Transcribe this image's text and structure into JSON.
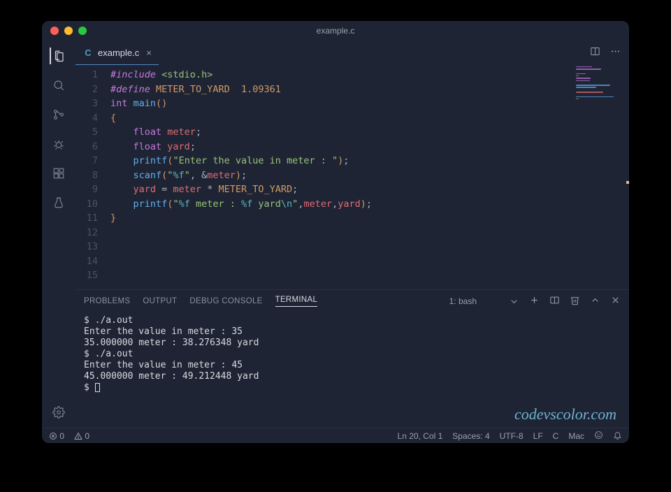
{
  "window": {
    "title": "example.c"
  },
  "tab": {
    "icon_letter": "C",
    "label": "example.c"
  },
  "activity": {
    "items": [
      "explorer",
      "search",
      "source-control",
      "debug",
      "extensions",
      "testing"
    ],
    "bottom": [
      "settings"
    ]
  },
  "editor": {
    "lines": [
      {
        "n": 1,
        "tokens": [
          [
            "c-include",
            "#include"
          ],
          [
            "c-punct",
            " "
          ],
          [
            "c-angle",
            "<stdio.h>"
          ]
        ]
      },
      {
        "n": 2,
        "tokens": [
          [
            "c-include",
            "#define"
          ],
          [
            "c-punct",
            " "
          ],
          [
            "c-const",
            "METER_TO_YARD"
          ],
          [
            "c-punct",
            "  "
          ],
          [
            "c-number",
            "1.09361"
          ]
        ]
      },
      {
        "n": 3,
        "tokens": [
          [
            "c-punct",
            ""
          ]
        ]
      },
      {
        "n": 4,
        "tokens": [
          [
            "c-type",
            "int"
          ],
          [
            "c-punct",
            " "
          ],
          [
            "c-func",
            "main"
          ],
          [
            "c-brace",
            "()"
          ]
        ]
      },
      {
        "n": 5,
        "tokens": [
          [
            "c-brace",
            "{"
          ]
        ]
      },
      {
        "n": 6,
        "tokens": [
          [
            "c-punct",
            "    "
          ],
          [
            "c-type",
            "float"
          ],
          [
            "c-punct",
            " "
          ],
          [
            "c-ident",
            "meter"
          ],
          [
            "c-punct",
            ";"
          ]
        ]
      },
      {
        "n": 7,
        "tokens": [
          [
            "c-punct",
            "    "
          ],
          [
            "c-type",
            "float"
          ],
          [
            "c-punct",
            " "
          ],
          [
            "c-ident",
            "yard"
          ],
          [
            "c-punct",
            ";"
          ]
        ]
      },
      {
        "n": 8,
        "tokens": [
          [
            "c-punct",
            ""
          ]
        ]
      },
      {
        "n": 9,
        "tokens": [
          [
            "c-punct",
            "    "
          ],
          [
            "c-func",
            "printf"
          ],
          [
            "c-brace",
            "("
          ],
          [
            "c-string",
            "\"Enter the value in meter : \""
          ],
          [
            "c-brace",
            ")"
          ],
          [
            "c-punct",
            ";"
          ]
        ]
      },
      {
        "n": 10,
        "tokens": [
          [
            "c-punct",
            "    "
          ],
          [
            "c-func",
            "scanf"
          ],
          [
            "c-brace",
            "("
          ],
          [
            "c-string",
            "\""
          ],
          [
            "c-str-emb",
            "%f"
          ],
          [
            "c-string",
            "\""
          ],
          [
            "c-punct",
            ", &"
          ],
          [
            "c-ident",
            "meter"
          ],
          [
            "c-brace",
            ")"
          ],
          [
            "c-punct",
            ";"
          ]
        ]
      },
      {
        "n": 11,
        "tokens": [
          [
            "c-punct",
            ""
          ]
        ]
      },
      {
        "n": 12,
        "tokens": [
          [
            "c-punct",
            "    "
          ],
          [
            "c-ident",
            "yard"
          ],
          [
            "c-punct",
            " = "
          ],
          [
            "c-ident",
            "meter"
          ],
          [
            "c-punct",
            " * "
          ],
          [
            "c-const",
            "METER_TO_YARD"
          ],
          [
            "c-punct",
            ";"
          ]
        ]
      },
      {
        "n": 13,
        "tokens": [
          [
            "c-punct",
            ""
          ]
        ]
      },
      {
        "n": 14,
        "tokens": [
          [
            "c-punct",
            "    "
          ],
          [
            "c-func",
            "printf"
          ],
          [
            "c-brace",
            "("
          ],
          [
            "c-string",
            "\""
          ],
          [
            "c-str-emb",
            "%f"
          ],
          [
            "c-string",
            " meter : "
          ],
          [
            "c-str-emb",
            "%f"
          ],
          [
            "c-string",
            " yard"
          ],
          [
            "c-str-emb",
            "\\n"
          ],
          [
            "c-string",
            "\""
          ],
          [
            "c-punct",
            ","
          ],
          [
            "c-ident",
            "meter"
          ],
          [
            "c-punct",
            ","
          ],
          [
            "c-ident",
            "yard"
          ],
          [
            "c-brace",
            ")"
          ],
          [
            "c-punct",
            ";"
          ]
        ]
      },
      {
        "n": 15,
        "tokens": [
          [
            "c-brace",
            "}"
          ]
        ]
      }
    ]
  },
  "panel": {
    "tabs": [
      "PROBLEMS",
      "OUTPUT",
      "DEBUG CONSOLE",
      "TERMINAL"
    ],
    "active_tab": "TERMINAL",
    "terminal_selector": "1: bash",
    "terminal_lines": [
      "$ ./a.out",
      "Enter the value in meter : 35",
      "35.000000 meter : 38.276348 yard",
      "$ ./a.out",
      "Enter the value in meter : 45",
      "45.000000 meter : 49.212448 yard"
    ],
    "prompt": "$ "
  },
  "status": {
    "errors": "0",
    "warnings": "0",
    "cursor": "Ln 20, Col 1",
    "spaces": "Spaces: 4",
    "encoding": "UTF-8",
    "eol": "LF",
    "lang": "C",
    "os": "Mac"
  },
  "watermark": "codevscolor.com"
}
